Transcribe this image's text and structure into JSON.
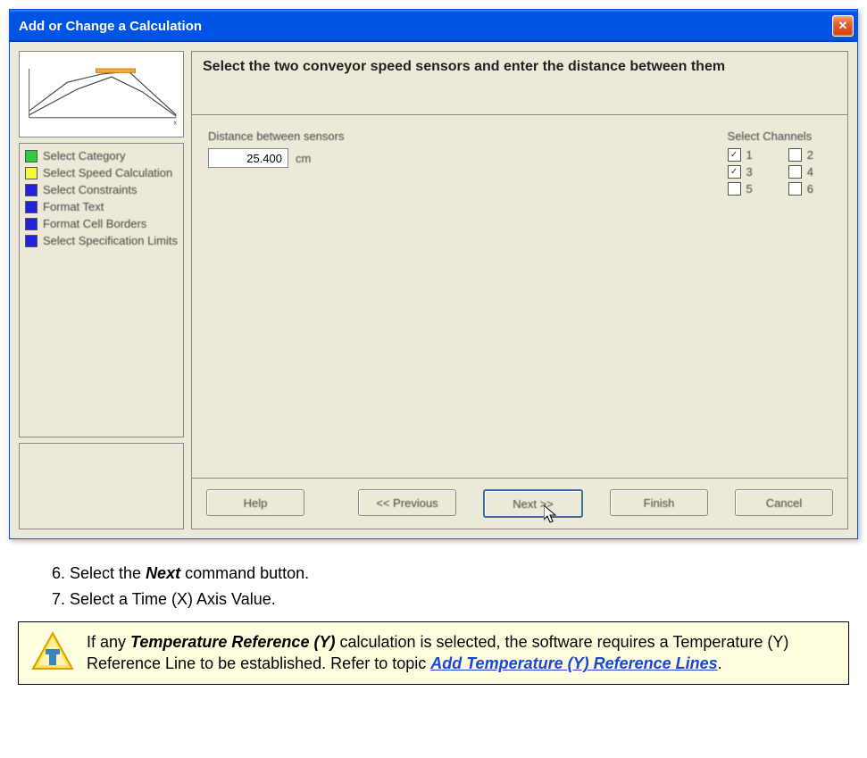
{
  "dialog": {
    "title": "Add or Change a Calculation",
    "instruction": "Select the two conveyor speed sensors and enter the distance between them",
    "nav": [
      {
        "label": "Select Category",
        "color": "#2ecc40"
      },
      {
        "label": "Select Speed Calculation",
        "color": "#f7f73a"
      },
      {
        "label": "Select Constraints",
        "color": "#2222dd"
      },
      {
        "label": "Format Text",
        "color": "#2222dd"
      },
      {
        "label": "Format Cell Borders",
        "color": "#2222dd"
      },
      {
        "label": "Select Specification Limits",
        "color": "#2222dd"
      }
    ],
    "distance": {
      "label": "Distance between sensors",
      "value": "25.400",
      "unit": "cm"
    },
    "channels": {
      "label": "Select Channels",
      "items": [
        {
          "n": "1",
          "checked": true
        },
        {
          "n": "2",
          "checked": false
        },
        {
          "n": "3",
          "checked": true
        },
        {
          "n": "4",
          "checked": false
        },
        {
          "n": "5",
          "checked": false
        },
        {
          "n": "6",
          "checked": false
        }
      ]
    },
    "buttons": {
      "help": "Help",
      "prev": "<< Previous",
      "next": "Next >>",
      "finish": "Finish",
      "cancel": "Cancel"
    }
  },
  "steps": {
    "s6_prefix": "Select the ",
    "s6_bold": "Next",
    "s6_suffix": " command button.",
    "s7": "Select a Time (X) Axis Value."
  },
  "note": {
    "t1": "If any ",
    "t2": "Temperature Reference (Y)",
    "t3": " calculation is selected, the software requires a Temperature (Y) Reference Line to be established. Refer to topic ",
    "link": "Add Temperature (Y) Reference Lines",
    "t4": "."
  }
}
